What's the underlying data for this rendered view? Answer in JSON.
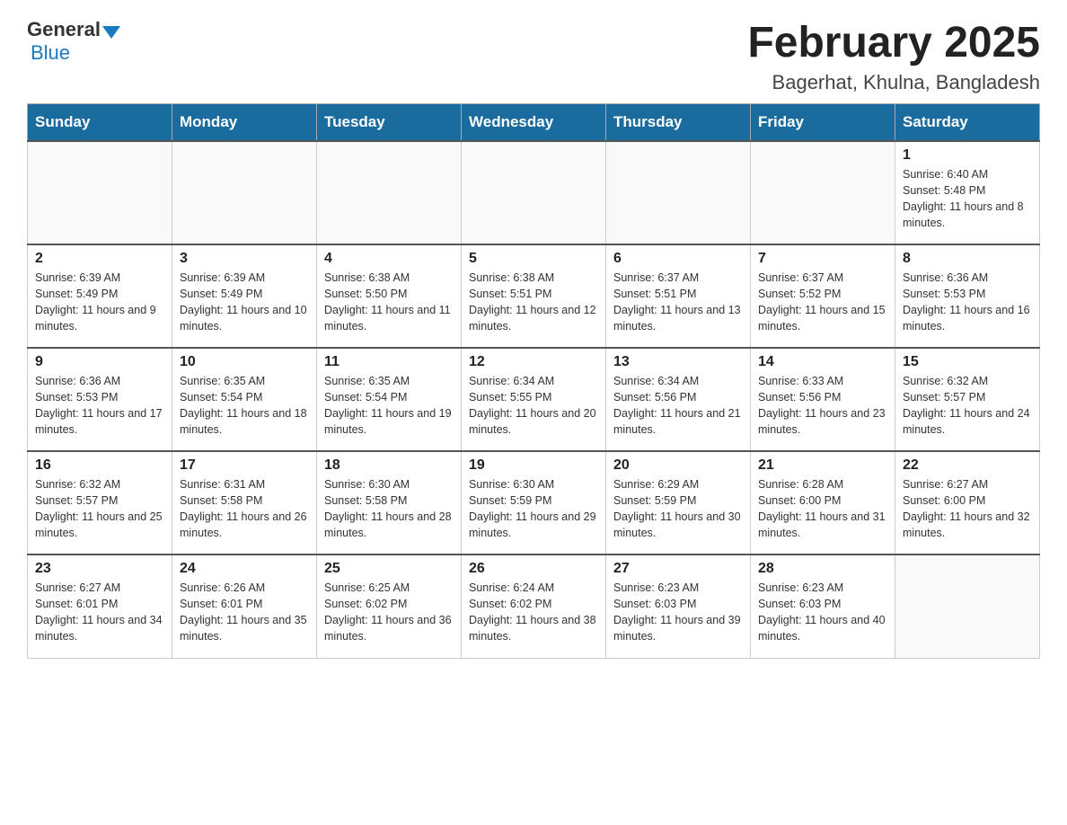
{
  "header": {
    "logo_general": "General",
    "logo_blue": "Blue",
    "month_title": "February 2025",
    "location": "Bagerhat, Khulna, Bangladesh"
  },
  "weekdays": [
    "Sunday",
    "Monday",
    "Tuesday",
    "Wednesday",
    "Thursday",
    "Friday",
    "Saturday"
  ],
  "weeks": [
    [
      {
        "day": "",
        "info": ""
      },
      {
        "day": "",
        "info": ""
      },
      {
        "day": "",
        "info": ""
      },
      {
        "day": "",
        "info": ""
      },
      {
        "day": "",
        "info": ""
      },
      {
        "day": "",
        "info": ""
      },
      {
        "day": "1",
        "info": "Sunrise: 6:40 AM\nSunset: 5:48 PM\nDaylight: 11 hours and 8 minutes."
      }
    ],
    [
      {
        "day": "2",
        "info": "Sunrise: 6:39 AM\nSunset: 5:49 PM\nDaylight: 11 hours and 9 minutes."
      },
      {
        "day": "3",
        "info": "Sunrise: 6:39 AM\nSunset: 5:49 PM\nDaylight: 11 hours and 10 minutes."
      },
      {
        "day": "4",
        "info": "Sunrise: 6:38 AM\nSunset: 5:50 PM\nDaylight: 11 hours and 11 minutes."
      },
      {
        "day": "5",
        "info": "Sunrise: 6:38 AM\nSunset: 5:51 PM\nDaylight: 11 hours and 12 minutes."
      },
      {
        "day": "6",
        "info": "Sunrise: 6:37 AM\nSunset: 5:51 PM\nDaylight: 11 hours and 13 minutes."
      },
      {
        "day": "7",
        "info": "Sunrise: 6:37 AM\nSunset: 5:52 PM\nDaylight: 11 hours and 15 minutes."
      },
      {
        "day": "8",
        "info": "Sunrise: 6:36 AM\nSunset: 5:53 PM\nDaylight: 11 hours and 16 minutes."
      }
    ],
    [
      {
        "day": "9",
        "info": "Sunrise: 6:36 AM\nSunset: 5:53 PM\nDaylight: 11 hours and 17 minutes."
      },
      {
        "day": "10",
        "info": "Sunrise: 6:35 AM\nSunset: 5:54 PM\nDaylight: 11 hours and 18 minutes."
      },
      {
        "day": "11",
        "info": "Sunrise: 6:35 AM\nSunset: 5:54 PM\nDaylight: 11 hours and 19 minutes."
      },
      {
        "day": "12",
        "info": "Sunrise: 6:34 AM\nSunset: 5:55 PM\nDaylight: 11 hours and 20 minutes."
      },
      {
        "day": "13",
        "info": "Sunrise: 6:34 AM\nSunset: 5:56 PM\nDaylight: 11 hours and 21 minutes."
      },
      {
        "day": "14",
        "info": "Sunrise: 6:33 AM\nSunset: 5:56 PM\nDaylight: 11 hours and 23 minutes."
      },
      {
        "day": "15",
        "info": "Sunrise: 6:32 AM\nSunset: 5:57 PM\nDaylight: 11 hours and 24 minutes."
      }
    ],
    [
      {
        "day": "16",
        "info": "Sunrise: 6:32 AM\nSunset: 5:57 PM\nDaylight: 11 hours and 25 minutes."
      },
      {
        "day": "17",
        "info": "Sunrise: 6:31 AM\nSunset: 5:58 PM\nDaylight: 11 hours and 26 minutes."
      },
      {
        "day": "18",
        "info": "Sunrise: 6:30 AM\nSunset: 5:58 PM\nDaylight: 11 hours and 28 minutes."
      },
      {
        "day": "19",
        "info": "Sunrise: 6:30 AM\nSunset: 5:59 PM\nDaylight: 11 hours and 29 minutes."
      },
      {
        "day": "20",
        "info": "Sunrise: 6:29 AM\nSunset: 5:59 PM\nDaylight: 11 hours and 30 minutes."
      },
      {
        "day": "21",
        "info": "Sunrise: 6:28 AM\nSunset: 6:00 PM\nDaylight: 11 hours and 31 minutes."
      },
      {
        "day": "22",
        "info": "Sunrise: 6:27 AM\nSunset: 6:00 PM\nDaylight: 11 hours and 32 minutes."
      }
    ],
    [
      {
        "day": "23",
        "info": "Sunrise: 6:27 AM\nSunset: 6:01 PM\nDaylight: 11 hours and 34 minutes."
      },
      {
        "day": "24",
        "info": "Sunrise: 6:26 AM\nSunset: 6:01 PM\nDaylight: 11 hours and 35 minutes."
      },
      {
        "day": "25",
        "info": "Sunrise: 6:25 AM\nSunset: 6:02 PM\nDaylight: 11 hours and 36 minutes."
      },
      {
        "day": "26",
        "info": "Sunrise: 6:24 AM\nSunset: 6:02 PM\nDaylight: 11 hours and 38 minutes."
      },
      {
        "day": "27",
        "info": "Sunrise: 6:23 AM\nSunset: 6:03 PM\nDaylight: 11 hours and 39 minutes."
      },
      {
        "day": "28",
        "info": "Sunrise: 6:23 AM\nSunset: 6:03 PM\nDaylight: 11 hours and 40 minutes."
      },
      {
        "day": "",
        "info": ""
      }
    ]
  ]
}
